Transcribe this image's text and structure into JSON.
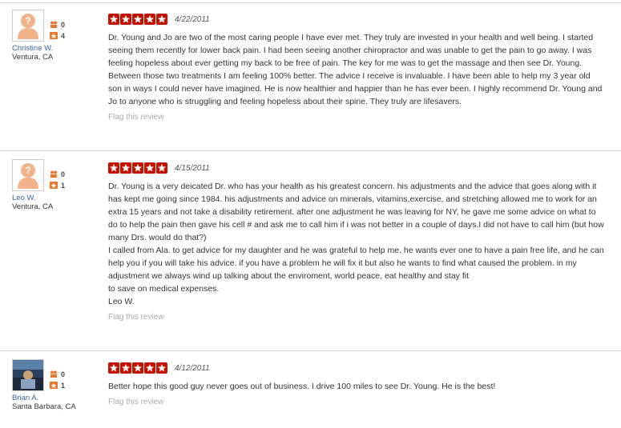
{
  "reviews": [
    {
      "user": {
        "name": "Christine W.",
        "location": "Ventura, CA",
        "friends": "0",
        "reviews": "4",
        "avatar": "default-person-icon"
      },
      "rating": 5,
      "date": "4/22/2011",
      "text": "Dr. Young and Jo are two of the most caring people I have ever met.  They truly are invested in your health and well being. I started seeing them recently for lower  back pain.  I had been seeing another chiropractor and was unable to get the pain to go away. I was feeling hopeless about ever getting my back to be free of pain.  The key for me was to get the massage and then see Dr. Young.  Between those two treatments I am feeling 100%  better. The advice I receive is invaluable.  I have been able to help my 3 year old son in ways I could never have imagined.  He is now healthier and happier than he has ever been.  I highly recommend Dr. Young and Jo to anyone who is struggling and feeling hopeless about their spine. They truly are lifesavers.",
      "flag_label": "Flag this review"
    },
    {
      "user": {
        "name": "Leo W.",
        "location": "Ventura, CA",
        "friends": "0",
        "reviews": "1",
        "avatar": "default-person-icon"
      },
      "rating": 5,
      "date": "4/15/2011",
      "text": "Dr. Young is a very deicated Dr. who has your health as his greatest concern. his adjustments and the advice that goes along with it has kept me going since 1984. his adjustments and advice on minerals, vitamins,exercise, and stretching allowed me to work for an extra 15 years and not take a disability retirement. after one adjustment he was leaving for NY, he gave me some advice on what to do to help the pain then gave  his cell # and ask me to call him if i was not better in a couple of days.I did not have to call him (but how many Drs. would do that?)\nI called from Ala. to get advice for my daughter and he was grateful to help me. he wants ever one to have a pain free life, and he can help you if you will take his advice. if you have a problem he will fix it but also he wants to find what caused the problem. in my adjustment we always wind up talking about the enviroment, world peace, eat healthy and stay fit\nto save on medical expenses.\nLeo W.",
      "flag_label": "Flag this review"
    },
    {
      "user": {
        "name": "Brian A.",
        "location": "Santa Barbara, CA",
        "friends": "0",
        "reviews": "1",
        "avatar": "user-photo"
      },
      "rating": 5,
      "date": "4/12/2011",
      "text": "Better hope this good guy never goes out of business. I drive 100 miles to see Dr. Young. He is the best!",
      "flag_label": "Flag this review"
    }
  ],
  "colors": {
    "star": "#c41200",
    "username": "#3b65a7",
    "stat_icon": "#e8772e",
    "flag": "#aaaaaa"
  },
  "icons": {
    "friends": "friends-icon",
    "reviews": "review-count-icon",
    "star": "star-icon"
  }
}
